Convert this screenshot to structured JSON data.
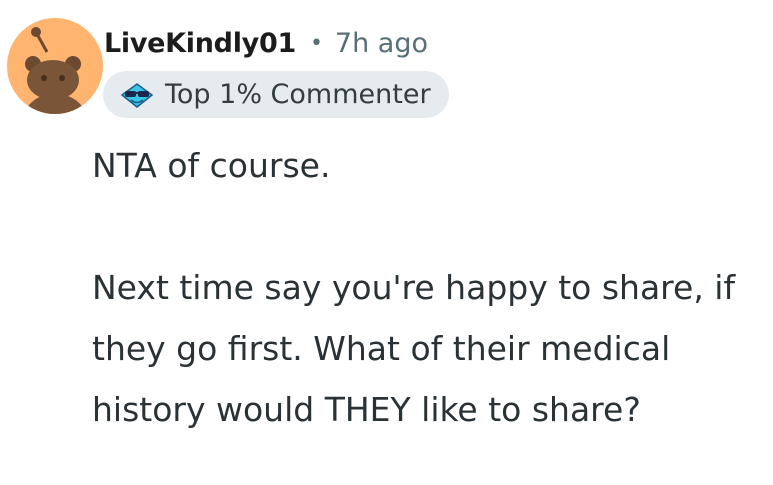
{
  "comment": {
    "author": "LiveKindly01",
    "separator": "•",
    "timestamp": "7h ago",
    "flair": {
      "icon": "sunglasses-emoji-icon",
      "label": "Top 1% Commenter"
    },
    "avatar": {
      "icon": "snoo-avatar-icon",
      "background": "#ffb470"
    },
    "paragraphs": [
      "NTA of course.",
      "Next time say you're happy to share, if they go first. What of their medical history would THEY like to share?"
    ]
  },
  "colors": {
    "username": "#1c1c1c",
    "meta": "#576f76",
    "flair_bg": "#e5ebee",
    "body_text": "#2a3236"
  }
}
